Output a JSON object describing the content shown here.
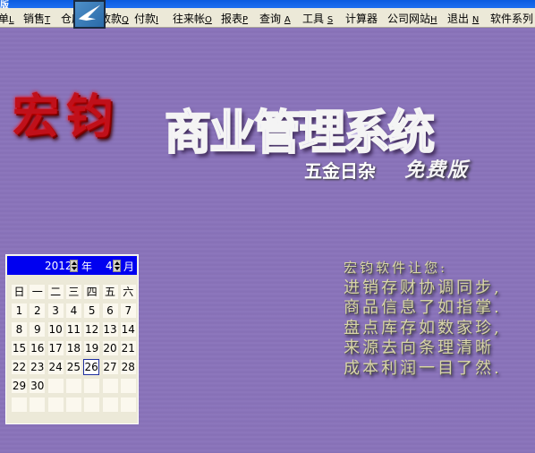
{
  "titlebar": {
    "text": "版"
  },
  "menu": [
    {
      "label": "单",
      "key": "L"
    },
    {
      "label": "销售",
      "key": "T"
    },
    {
      "label": "仓库",
      "key": ""
    },
    {
      "label": "收款",
      "key": "Q"
    },
    {
      "label": "付款",
      "key": "I"
    },
    {
      "label": "往来帐",
      "key": "O"
    },
    {
      "label": "报表",
      "key": "P"
    },
    {
      "label": "查询 ",
      "key": "A"
    },
    {
      "label": "工具 ",
      "key": "S"
    },
    {
      "label": "计算器",
      "key": ""
    },
    {
      "label": "公司网站",
      "key": "H"
    },
    {
      "label": "退出 ",
      "key": "N"
    },
    {
      "label": "软件系列",
      "key": ""
    }
  ],
  "logo": {
    "brand": "宏钧",
    "product": "商业管理系统",
    "edition": "五金日杂",
    "free": "免费版"
  },
  "poem": [
    "宏钧软件让您:",
    "进销存财协调同步,",
    "商品信息了如指掌.",
    "盘点库存如数家珍,",
    "来源去向条理清晰",
    "成本利润一目了然."
  ],
  "calendar": {
    "year": "2012",
    "year_label": "年",
    "month": "4",
    "month_label": "月",
    "weekdays": [
      "日",
      "一",
      "二",
      "三",
      "四",
      "五",
      "六"
    ],
    "first_weekday": 0,
    "days": 30,
    "selected": 26
  }
}
